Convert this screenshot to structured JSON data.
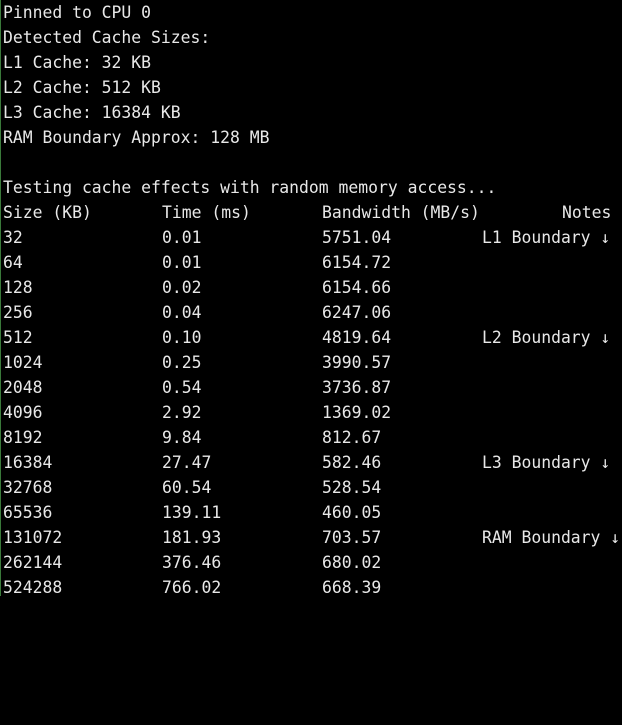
{
  "header_lines": [
    "Pinned to CPU 0",
    "Detected Cache Sizes:",
    "L1 Cache: 32 KB",
    "L2 Cache: 512 KB",
    "L3 Cache: 16384 KB",
    "RAM Boundary Approx: 128 MB"
  ],
  "testing_line": "Testing cache effects with random memory access...",
  "table": {
    "columns": [
      "Size (KB)",
      "Time (ms)",
      "Bandwidth (MB/s)",
      "Notes"
    ],
    "rows": [
      {
        "size": "32",
        "time": "0.01",
        "bandwidth": "5751.04",
        "note": "L1 Boundary ↓"
      },
      {
        "size": "64",
        "time": "0.01",
        "bandwidth": "6154.72",
        "note": ""
      },
      {
        "size": "128",
        "time": "0.02",
        "bandwidth": "6154.66",
        "note": ""
      },
      {
        "size": "256",
        "time": "0.04",
        "bandwidth": "6247.06",
        "note": ""
      },
      {
        "size": "512",
        "time": "0.10",
        "bandwidth": "4819.64",
        "note": "L2 Boundary ↓"
      },
      {
        "size": "1024",
        "time": "0.25",
        "bandwidth": "3990.57",
        "note": ""
      },
      {
        "size": "2048",
        "time": "0.54",
        "bandwidth": "3736.87",
        "note": ""
      },
      {
        "size": "4096",
        "time": "2.92",
        "bandwidth": "1369.02",
        "note": ""
      },
      {
        "size": "8192",
        "time": "9.84",
        "bandwidth": "812.67",
        "note": ""
      },
      {
        "size": "16384",
        "time": "27.47",
        "bandwidth": "582.46",
        "note": "L3 Boundary ↓"
      },
      {
        "size": "32768",
        "time": "60.54",
        "bandwidth": "528.54",
        "note": ""
      },
      {
        "size": "65536",
        "time": "139.11",
        "bandwidth": "460.05",
        "note": ""
      },
      {
        "size": "131072",
        "time": "181.93",
        "bandwidth": "703.57",
        "note": "RAM Boundary ↓"
      },
      {
        "size": "262144",
        "time": "376.46",
        "bandwidth": "680.02",
        "note": ""
      },
      {
        "size": "524288",
        "time": "766.02",
        "bandwidth": "668.39",
        "note": ""
      }
    ]
  },
  "colors": {
    "background": "#000000",
    "text": "#e8e8e8",
    "left_border": "#3a7a3a"
  }
}
